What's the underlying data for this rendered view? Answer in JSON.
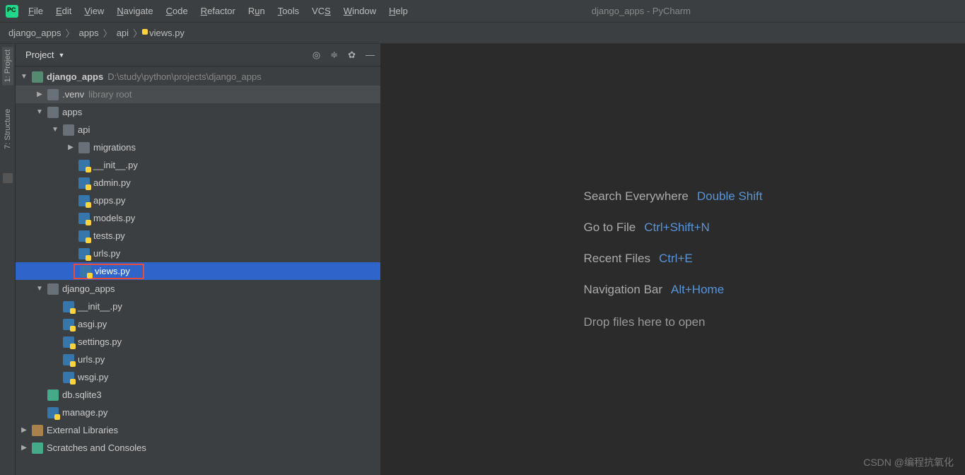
{
  "window_title": "django_apps - PyCharm",
  "menu": [
    "File",
    "Edit",
    "View",
    "Navigate",
    "Code",
    "Refactor",
    "Run",
    "Tools",
    "VCS",
    "Window",
    "Help"
  ],
  "breadcrumb": [
    "django_apps",
    "apps",
    "api",
    "views.py"
  ],
  "sidebar": {
    "title": "Project"
  },
  "tree": {
    "root": {
      "name": "django_apps",
      "path": "D:\\study\\python\\projects\\django_apps"
    },
    "venv": {
      "name": ".venv",
      "note": "library root"
    },
    "apps": "apps",
    "api": "api",
    "migrations": "migrations",
    "api_files": [
      "__init__.py",
      "admin.py",
      "apps.py",
      "models.py",
      "tests.py",
      "urls.py",
      "views.py"
    ],
    "django_apps_pkg": "django_apps",
    "pkg_files": [
      "__init__.py",
      "asgi.py",
      "settings.py",
      "urls.py",
      "wsgi.py"
    ],
    "db": "db.sqlite3",
    "manage": "manage.py",
    "ext_lib": "External Libraries",
    "scratches": "Scratches and Consoles"
  },
  "gutter": {
    "project": "1: Project",
    "structure": "7: Structure"
  },
  "hints": [
    {
      "label": "Search Everywhere",
      "key": "Double Shift"
    },
    {
      "label": "Go to File",
      "key": "Ctrl+Shift+N"
    },
    {
      "label": "Recent Files",
      "key": "Ctrl+E"
    },
    {
      "label": "Navigation Bar",
      "key": "Alt+Home"
    }
  ],
  "drop_text": "Drop files here to open",
  "watermark": "CSDN @编程抗氧化"
}
